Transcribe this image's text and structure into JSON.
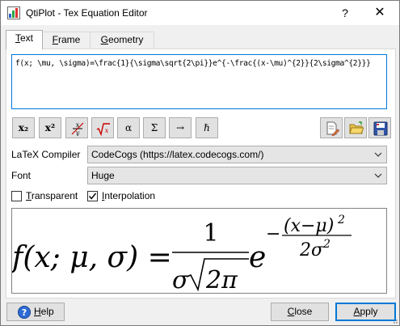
{
  "window": {
    "title": "QtiPlot - Tex Equation Editor",
    "help_glyph": "?",
    "close_glyph": "✕"
  },
  "tabs": [
    {
      "label_ul": "T",
      "label_rest": "ext"
    },
    {
      "label_ul": "F",
      "label_rest": "rame"
    },
    {
      "label_ul": "G",
      "label_rest": "eometry"
    }
  ],
  "editor": {
    "value": "f(x; \\mu, \\sigma)=\\frac{1}{\\sigma\\sqrt{2\\pi}}e^{-\\frac{(x-\\mu)^{2}}{2\\sigma^{2}}}"
  },
  "toolbar": {
    "subscript": "x₂",
    "superscript": "x²",
    "greek_alpha": "α",
    "greek_sigma": "Σ",
    "arrow": "→",
    "hbar": "ℏ"
  },
  "compiler": {
    "label": "LaTeX Compiler",
    "value": "CodeCogs (https://latex.codecogs.com/)"
  },
  "font": {
    "label": "Font",
    "value": "Huge"
  },
  "options": {
    "transparent": {
      "label_ul": "T",
      "label_rest": "ransparent",
      "checked": false
    },
    "interpolation": {
      "label_ul": "I",
      "label_rest": "nterpolation",
      "checked": true
    }
  },
  "preview_formula": {
    "lhs": "f(x; μ, σ) =",
    "frac_num": "1",
    "frac_den_sigma": "σ",
    "frac_den_sqrt": "2π",
    "e": "e",
    "exp_minus": "−",
    "exp_num": "(x−μ)",
    "exp_num_pow": "2",
    "exp_den": "2σ",
    "exp_den_pow": "2"
  },
  "buttons": {
    "help": {
      "label_ul": "H",
      "label_rest": "elp"
    },
    "close": {
      "label_ul": "C",
      "label_rest": "lose"
    },
    "apply": {
      "label_ul": "A",
      "label_rest": "pply"
    }
  }
}
